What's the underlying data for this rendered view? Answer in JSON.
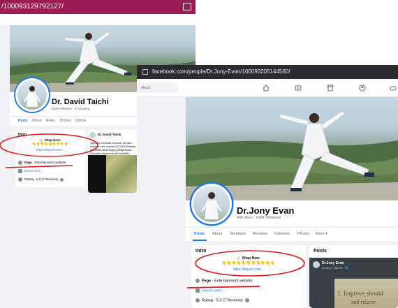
{
  "left": {
    "url": "/100093129792127/",
    "profile_name": "Dr. David Taichi",
    "profile_sub": "5526 followers · 5 following",
    "tabs": [
      "Posts",
      "About",
      "Reels",
      "Photos",
      "Videos"
    ],
    "intro_title": "Intro",
    "shop_now": "🛒 Shop Now:",
    "shop_link": "https://tinyurl.com/...",
    "page_label": "Page",
    "page_category": "Entertainment website",
    "site": "tinyurl.com/...",
    "rating": "Rating · 5.0 (7 Reviews)",
    "post_author": "Dr. David Taichi",
    "post_text": "Specific exercise improve sympto... remove root causes #TCM #Chinese #Tinnitus #Earringing #Depressio... #Anxiety #Insomnia #Prostatitis..."
  },
  "right": {
    "url": "facebook.com/people/Dr.Jony-Evan/100093205144560/",
    "search_placeholder": "ebook",
    "profile_name": "Dr.Jony Evan",
    "profile_sub": "49K likes · 108K followers",
    "tabs": [
      "Posts",
      "About",
      "Mentions",
      "Reviews",
      "Followers",
      "Photos",
      "More ▾"
    ],
    "intro_title": "Intro",
    "shop_now": "🛒 Shop Now:",
    "shop_link": "https://tinyurl.com/...",
    "page_label": "Page",
    "page_category": "Entertainment website",
    "site": "tinyurl.com/...",
    "rating": "Rating · 5.0 (7 Reviews)",
    "posts_title": "Posts",
    "post_author": "Dr.Jony Evan",
    "post_meta": "Dr.Jony · Mar 29 · 🌐",
    "post_image_text_1": "1. Improve should",
    "post_image_text_2": "and relieve"
  },
  "colors": {
    "fb_blue": "#1877f2",
    "annotation_red": "#d9161b",
    "browser_tab_left": "#9b1c54",
    "browser_bar_right": "#2a2b2e"
  }
}
